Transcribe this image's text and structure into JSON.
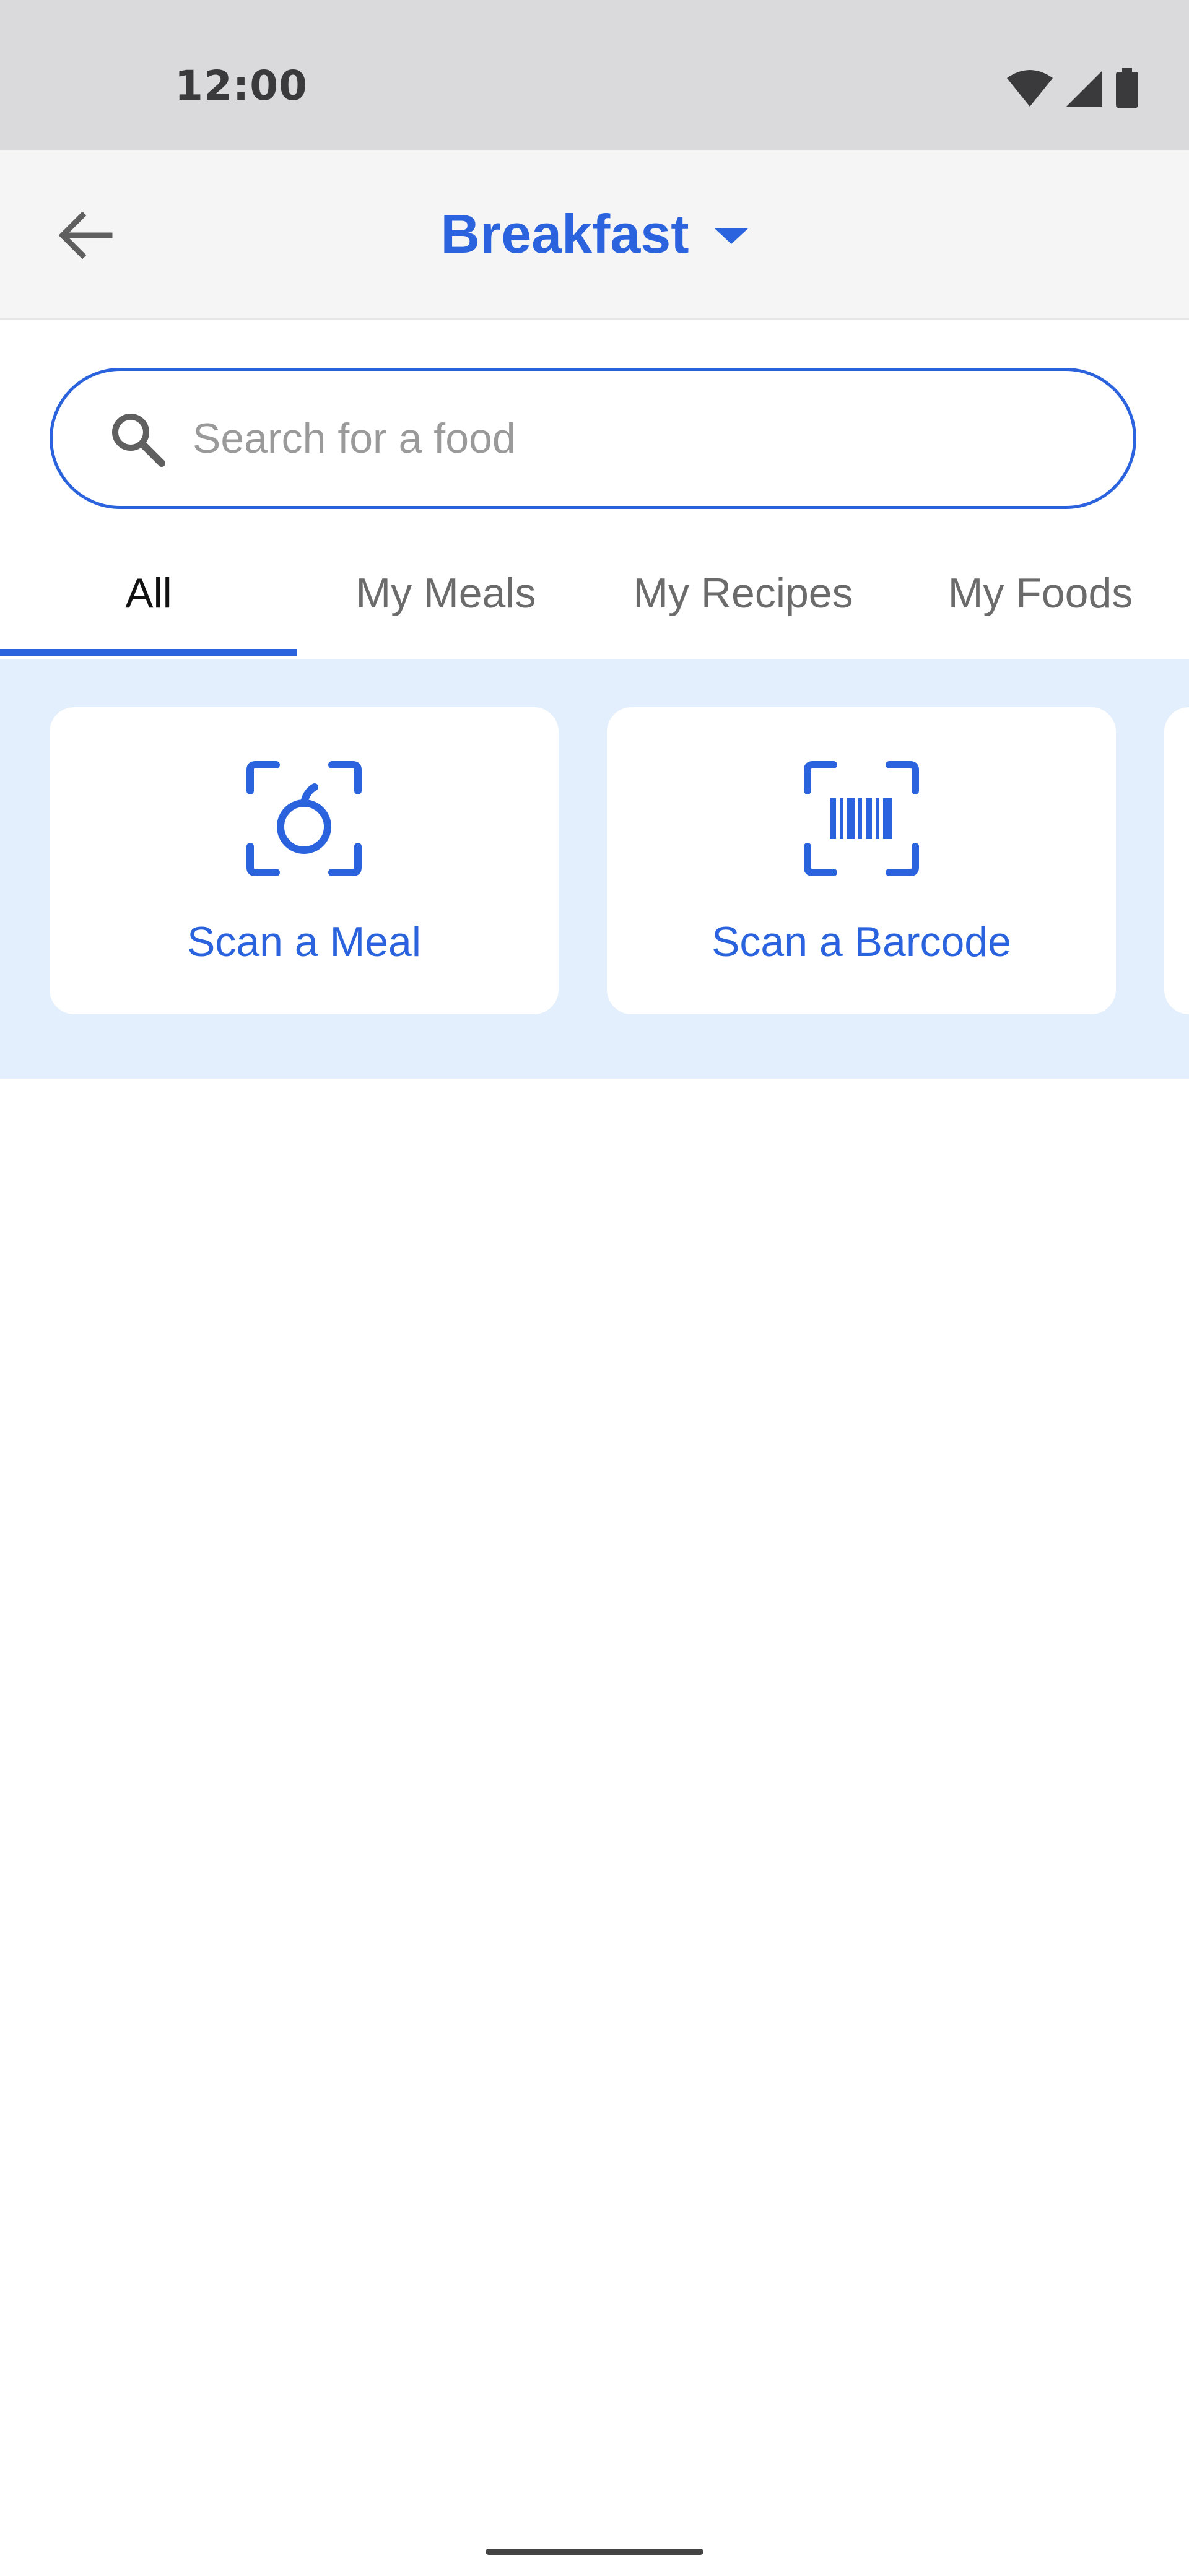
{
  "status_bar": {
    "time": "12:00",
    "icons": [
      "wifi-icon",
      "cellular-signal-icon",
      "battery-icon"
    ]
  },
  "app_bar": {
    "back_icon": "arrow-back-icon",
    "title": "Breakfast",
    "dropdown_icon": "caret-down-icon"
  },
  "search": {
    "icon": "search-icon",
    "placeholder": "Search for a food",
    "value": ""
  },
  "tabs": [
    {
      "label": "All",
      "active": true
    },
    {
      "label": "My Meals",
      "active": false
    },
    {
      "label": "My Recipes",
      "active": false
    },
    {
      "label": "My Foods",
      "active": false
    }
  ],
  "scan_options": [
    {
      "label": "Scan a Meal",
      "icon": "scan-meal-icon"
    },
    {
      "label": "Scan a Barcode",
      "icon": "barcode-scan-icon"
    }
  ],
  "colors": {
    "accent": "#2a63dd",
    "status_bar_bg": "#dadadc",
    "app_bar_bg": "#f5f5f5",
    "scan_section_bg": "#e3effc",
    "card_bg": "#ffffff",
    "inactive_tab_text": "#6b6b6b"
  }
}
